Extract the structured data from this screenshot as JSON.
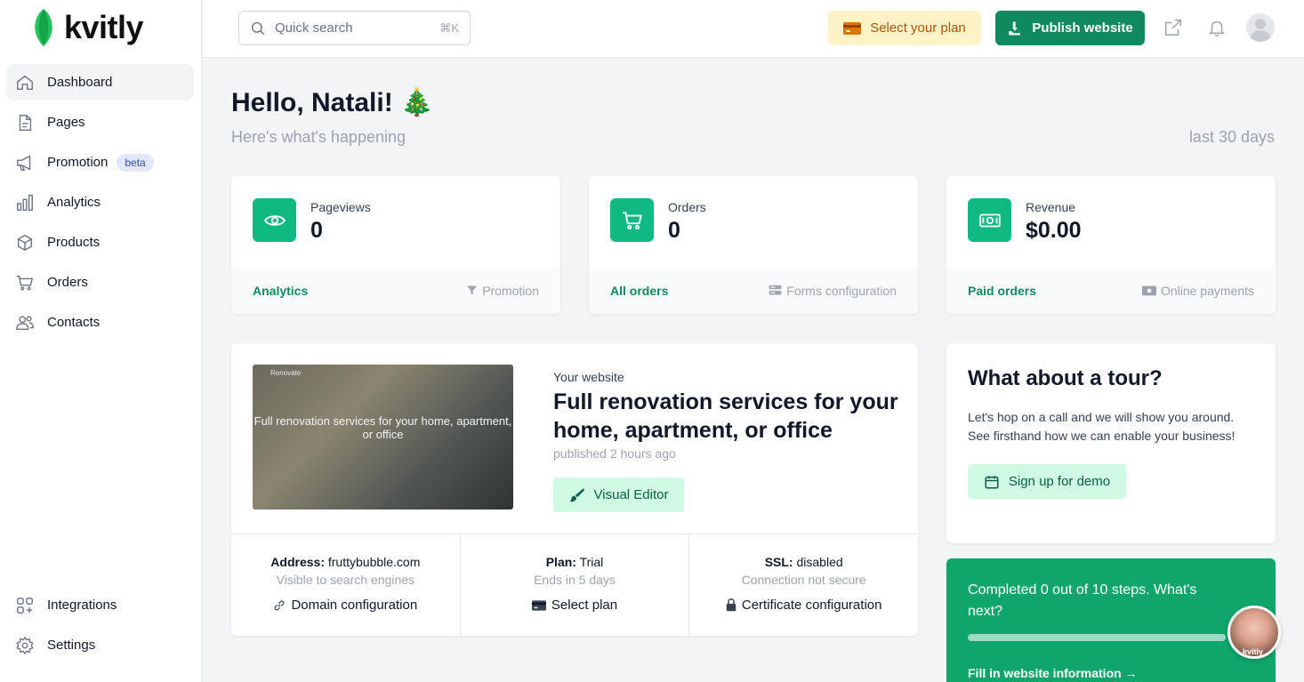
{
  "brand": {
    "name": "kvitly"
  },
  "sidebar": {
    "items": [
      {
        "label": "Dashboard",
        "icon": "home-icon",
        "active": true
      },
      {
        "label": "Pages",
        "icon": "document-icon"
      },
      {
        "label": "Promotion",
        "icon": "megaphone-icon",
        "badge": "beta"
      },
      {
        "label": "Analytics",
        "icon": "bar-chart-icon"
      },
      {
        "label": "Products",
        "icon": "box-icon"
      },
      {
        "label": "Orders",
        "icon": "cart-icon"
      },
      {
        "label": "Contacts",
        "icon": "users-icon"
      }
    ],
    "bottom": [
      {
        "label": "Integrations",
        "icon": "integrations-icon"
      },
      {
        "label": "Settings",
        "icon": "gear-icon"
      }
    ]
  },
  "topbar": {
    "search_placeholder": "Quick search",
    "search_shortcut": "⌘K",
    "plan_button": "Select your plan",
    "publish_button": "Publish website"
  },
  "main": {
    "greeting": "Hello, Natali! 🎄",
    "subtitle": "Here's what's happening",
    "range": "last 30 days"
  },
  "stats": [
    {
      "label": "Pageviews",
      "value": "0",
      "link": "Analytics",
      "secondary": "Promotion"
    },
    {
      "label": "Orders",
      "value": "0",
      "link": "All orders",
      "secondary": "Forms configuration"
    },
    {
      "label": "Revenue",
      "value": "$0.00",
      "link": "Paid orders",
      "secondary": "Online payments"
    }
  ],
  "website": {
    "thumb_brand": "Renovate",
    "thumb_title": "Full renovation services for your home, apartment, or office",
    "label": "Your website",
    "title": "Full renovation services for your home, apartment, or office",
    "published": "published 2 hours ago",
    "editor_button": "Visual Editor",
    "address_label": "Address:",
    "address": "fruttybubble.com",
    "address_note": "Visible to search engines",
    "address_link": "Domain configuration",
    "plan_label": "Plan:",
    "plan": "Trial",
    "plan_note": "Ends in 5 days",
    "plan_link": "Select plan",
    "ssl_label": "SSL:",
    "ssl": "disabled",
    "ssl_note": "Connection not secure",
    "ssl_link": "Certificate configuration"
  },
  "tour": {
    "title": "What about a tour?",
    "text": "Let's hop on a call and we will show you around. See firsthand how we can enable your business!",
    "button": "Sign up for demo"
  },
  "steps": {
    "title": "Completed 0 out of 10 steps. What's next?",
    "progress": 0,
    "next": "Fill in website information →",
    "avatar_text": "kvitly"
  },
  "colors": {
    "accent": "#0f8a5f",
    "accent_light": "#d1fae5",
    "stat_icon": "#10b981",
    "plan_bg": "#fef3c7"
  }
}
